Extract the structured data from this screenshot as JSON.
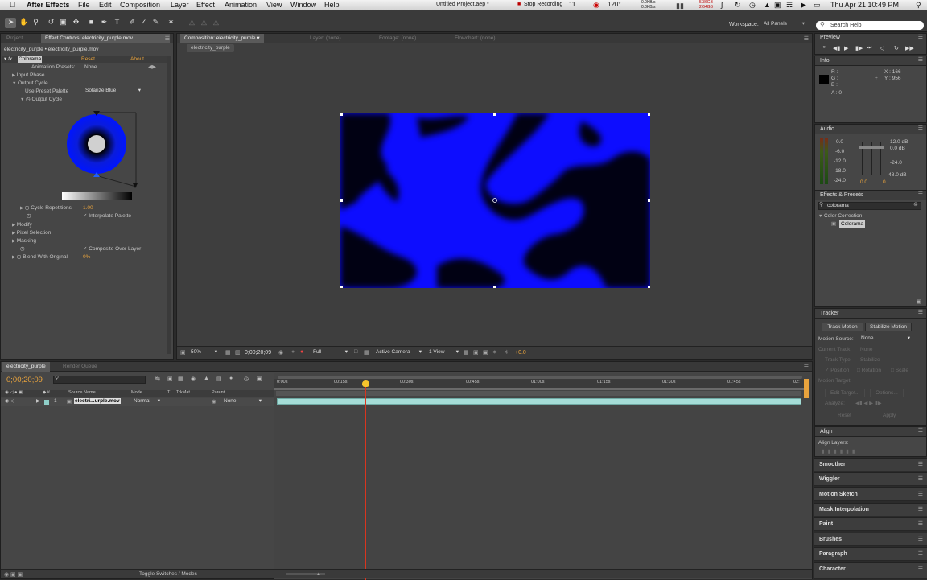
{
  "menubar": {
    "apple": "",
    "app": "After Effects",
    "items": [
      "File",
      "Edit",
      "Composition",
      "Layer",
      "Effect",
      "Animation",
      "View",
      "Window",
      "Help"
    ],
    "title": "Untitled Project.aep *",
    "status": {
      "record": "Stop Recording",
      "adobe": "11",
      "temp": "120°",
      "net1": "0.0KB/s",
      "net2": "0.0KB/s",
      "mem1": "5.36GB",
      "mem2": "2.64GB",
      "datetime": "Thu Apr 21  10:49 PM"
    }
  },
  "toolbar": {
    "workspace_label": "Workspace:",
    "workspace_value": "All Panels",
    "search_help": "Search Help"
  },
  "project_panel": {
    "tab_project": "Project",
    "tab_effect_controls": "Effect Controls: electricity_purple.mov",
    "breadcrumb": "electricity_purple • electricity_purple.mov",
    "effect_name": "Colorama",
    "reset": "Reset",
    "about": "About...",
    "animation_presets_label": "Animation Presets:",
    "animation_presets_value": "None",
    "input_phase": "Input Phase",
    "output_cycle": "Output Cycle",
    "use_preset_palette_label": "Use Preset Palette",
    "use_preset_palette_value": "Solarize Blue",
    "output_cycle_sub": "Output Cycle",
    "cycle_repetitions_label": "Cycle Repetitions",
    "cycle_repetitions_value": "1.00",
    "interpolate_palette": "Interpolate Palette",
    "modify": "Modify",
    "pixel_selection": "Pixel Selection",
    "masking": "Masking",
    "composite_over_layer": "Composite Over Layer",
    "blend_with_original_label": "Blend With Original",
    "blend_with_original_value": "0%"
  },
  "composition_panel": {
    "tab_composition": "Composition: electricity_purple",
    "tab_layer": "Layer: (none)",
    "tab_footage": "Footage: (none)",
    "tab_flowchart": "Flowchart: (none)",
    "comp_subtab": "electricity_purple",
    "footer": {
      "zoom": "50%",
      "timecode": "0;00;20;09",
      "resolution": "Full",
      "camera": "Active Camera",
      "view": "1 View",
      "exposure": "+0.0"
    }
  },
  "preview_panel": {
    "title": "Preview"
  },
  "info_panel": {
    "title": "Info",
    "r": "R :",
    "g": "G :",
    "b": "B :",
    "a": "A : 0",
    "x": "X : 166",
    "y": "Y : 956"
  },
  "audio_panel": {
    "title": "Audio",
    "left_scale": [
      "0.0",
      "-6.0",
      "-12.0",
      "-18.0",
      "-24.0"
    ],
    "right_scale": [
      "12.0 dB",
      "0.0 dB",
      "-24.0",
      "-48.0 dB"
    ],
    "bottom_values": [
      "0.0",
      "0"
    ]
  },
  "effects_presets_panel": {
    "title": "Effects & Presets",
    "search_value": "colorama",
    "category": "Color Correction",
    "item": "Colorama"
  },
  "tracker_panel": {
    "title": "Tracker",
    "track_motion": "Track Motion",
    "stabilize_motion": "Stabilize Motion",
    "motion_source_label": "Motion Source:",
    "motion_source_value": "None",
    "current_track_label": "Current Track:",
    "current_track_value": "None",
    "track_type_label": "Track Type:",
    "track_type_value": "Stabilize",
    "position": "Position",
    "rotation": "Rotation",
    "scale": "Scale",
    "motion_target": "Motion Target:",
    "edit_target": "Edit Target...",
    "options": "Options...",
    "analyze": "Analyze:",
    "reset": "Reset",
    "apply": "Apply"
  },
  "align_panel": {
    "title": "Align",
    "align_layers": "Align Layers:"
  },
  "collapsed_panels": [
    "Smoother",
    "Wiggler",
    "Motion Sketch",
    "Mask Interpolation",
    "Paint",
    "Brushes",
    "Paragraph",
    "Character"
  ],
  "timeline": {
    "tab_comp": "electricity_purple",
    "tab_render": "Render Queue",
    "timecode": "0;00;20;09",
    "columns": {
      "source_name": "Source Name",
      "mode": "Mode",
      "t": "T",
      "trkmat": "TrkMat",
      "parent": "Parent"
    },
    "layer": {
      "num": "1",
      "name": "electri...urple.mov",
      "mode": "Normal",
      "parent": "None"
    },
    "ruler": [
      "0:00s",
      "00:15s",
      "00:30s",
      "00:45s",
      "01:00s",
      "01:15s",
      "01:30s",
      "01:45s",
      "02:"
    ],
    "toggle": "Toggle Switches / Modes"
  }
}
